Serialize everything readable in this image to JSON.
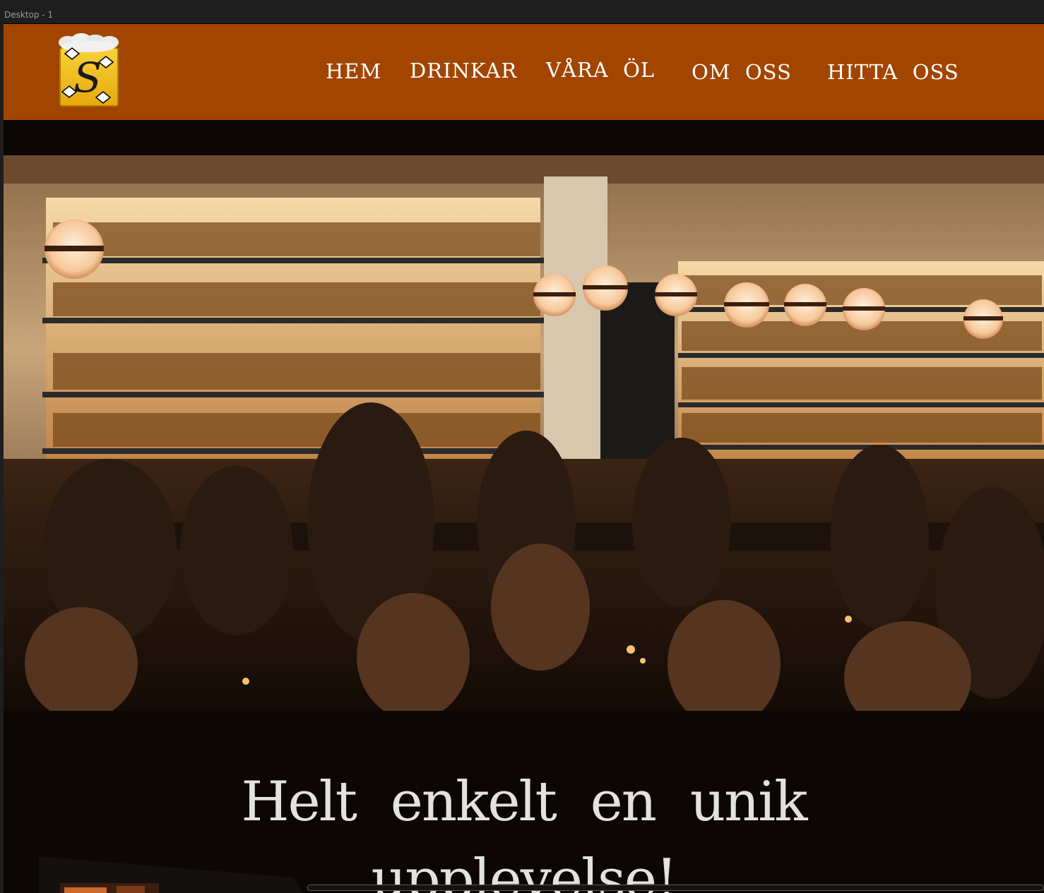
{
  "window": {
    "frame_label": "Desktop - 1"
  },
  "brand": {
    "logo_letter": "S"
  },
  "nav": {
    "items": [
      {
        "label": "HEM"
      },
      {
        "label": "DRINKAR"
      },
      {
        "label": "VÅRA  ÖL"
      },
      {
        "label": "OM  OSS"
      },
      {
        "label": "HITTA  OSS"
      }
    ]
  },
  "hero": {
    "image": "bar-interior-photo"
  },
  "main": {
    "headline_line1": "Helt enkelt en unik",
    "headline_line2": "upplevelse!"
  },
  "colors": {
    "navbar_bg": "#a24500",
    "page_bg": "#0c0704",
    "nav_text": "#ffffff",
    "headline_text": "#e2e2e2",
    "logo_yellow": "#f2c21b"
  }
}
